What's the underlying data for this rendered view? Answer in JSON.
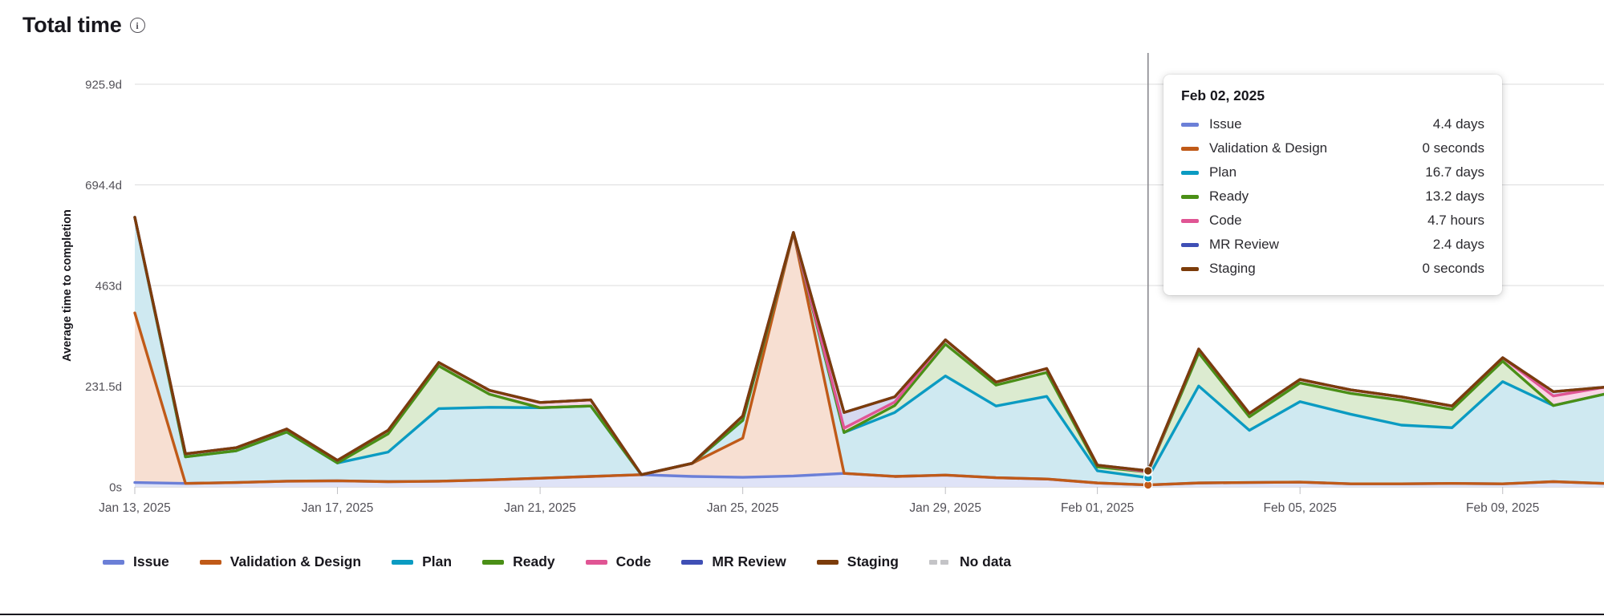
{
  "header": {
    "title": "Total time",
    "info_icon": "info-icon",
    "info_glyph": "i"
  },
  "chart_data": {
    "type": "area",
    "stacked": true,
    "title": "Total time",
    "xlabel": "",
    "ylabel": "Average time to completion",
    "grid": true,
    "legend_position": "bottom",
    "ylim": [
      0,
      925.9
    ],
    "y_ticks": [
      0,
      231.5,
      463,
      694.4,
      925.9
    ],
    "y_tick_labels": [
      "0s",
      "231.5d",
      "463d",
      "694.4d",
      "925.9d"
    ],
    "x_tick_labels": [
      "Jan 13, 2025",
      "Jan 17, 2025",
      "Jan 21, 2025",
      "Jan 25, 2025",
      "Jan 29, 2025",
      "Feb 01, 2025",
      "Feb 05, 2025",
      "Feb 09, 2025"
    ],
    "x_tick_indices": [
      0,
      4,
      8,
      12,
      16,
      19,
      23,
      27
    ],
    "x": [
      "Jan 13, 2025",
      "Jan 14, 2025",
      "Jan 15, 2025",
      "Jan 16, 2025",
      "Jan 17, 2025",
      "Jan 18, 2025",
      "Jan 19, 2025",
      "Jan 20, 2025",
      "Jan 21, 2025",
      "Jan 22, 2025",
      "Jan 23, 2025",
      "Jan 24, 2025",
      "Jan 25, 2025",
      "Jan 26, 2025",
      "Jan 27, 2025",
      "Jan 28, 2025",
      "Jan 29, 2025",
      "Jan 30, 2025",
      "Jan 31, 2025",
      "Feb 01, 2025",
      "Feb 02, 2025",
      "Feb 03, 2025",
      "Feb 04, 2025",
      "Feb 05, 2025",
      "Feb 06, 2025",
      "Feb 07, 2025",
      "Feb 08, 2025",
      "Feb 09, 2025",
      "Feb 10, 2025",
      "Feb 11, 2025"
    ],
    "series": [
      {
        "name": "Issue",
        "color": "#6b7fd7",
        "fill": "#dfe3f7",
        "values": [
          10,
          8,
          10,
          13,
          14,
          12,
          13,
          16,
          20,
          24,
          28,
          24,
          22,
          25,
          31,
          24,
          27,
          21,
          18,
          9,
          4.4,
          9,
          10,
          11,
          7,
          7,
          8,
          7,
          12,
          8
        ]
      },
      {
        "name": "Validation & Design",
        "color": "#c05a18",
        "fill": "#f7dfd2",
        "values": [
          390,
          0,
          0,
          0,
          0,
          0,
          0,
          0,
          0,
          0,
          0,
          30,
          90,
          560,
          0,
          0,
          0,
          0,
          0,
          0,
          0,
          0,
          0,
          0,
          0,
          0,
          0,
          0,
          0,
          0
        ]
      },
      {
        "name": "Plan",
        "color": "#0b9bc2",
        "fill": "#cfe9f1",
        "values": [
          220,
          61,
          73,
          113,
          41,
          68,
          167,
          167,
          162,
          162,
          0,
          0,
          41,
          0,
          94,
          147,
          228,
          165,
          190,
          28,
          16.7,
          223,
          120,
          185,
          160,
          135,
          128,
          235,
          175,
          205
        ]
      },
      {
        "name": "Ready",
        "color": "#4a8f16",
        "fill": "#dcebd0",
        "values": [
          0,
          0,
          0,
          0,
          0,
          42,
          98,
          30,
          0,
          0,
          0,
          0,
          0,
          0,
          0,
          16,
          73,
          48,
          55,
          9,
          13.2,
          76,
          31,
          43,
          48,
          57,
          42,
          47,
          0,
          0
        ]
      },
      {
        "name": "Code",
        "color": "#e05594",
        "fill": "#f9d6e6",
        "values": [
          0,
          7,
          7,
          7,
          6,
          8,
          8,
          9,
          12,
          14,
          0,
          0,
          10,
          0,
          10,
          8,
          10,
          7,
          9,
          4,
          0.2,
          9,
          8,
          8,
          8,
          8,
          8,
          8,
          22,
          16
        ]
      },
      {
        "name": "MR Review",
        "color": "#3f4fb5",
        "fill": "#d6d9f0",
        "values": [
          0,
          0,
          0,
          0,
          0,
          0,
          0,
          0,
          0,
          0,
          0,
          0,
          0,
          0,
          36,
          12,
          0,
          0,
          0,
          0,
          2.4,
          0,
          0,
          0,
          0,
          0,
          0,
          0,
          10,
          0
        ]
      },
      {
        "name": "Staging",
        "color": "#7c3c0a",
        "fill": "#e9ded6",
        "values": [
          0,
          0,
          0,
          0,
          0,
          0,
          0,
          0,
          0,
          0,
          0,
          0,
          0,
          0,
          0,
          0,
          0,
          0,
          0,
          0,
          0,
          0,
          0,
          0,
          0,
          0,
          0,
          0,
          0,
          0
        ]
      }
    ],
    "no_data_color": "#c4c4c7",
    "no_data_label": "No data",
    "hover_index": 20
  },
  "tooltip": {
    "date": "Feb 02, 2025",
    "rows": [
      {
        "name": "Issue",
        "value": "4.4 days",
        "color": "#6b7fd7"
      },
      {
        "name": "Validation & Design",
        "value": "0 seconds",
        "color": "#c05a18"
      },
      {
        "name": "Plan",
        "value": "16.7 days",
        "color": "#0b9bc2"
      },
      {
        "name": "Ready",
        "value": "13.2 days",
        "color": "#4a8f16"
      },
      {
        "name": "Code",
        "value": "4.7 hours",
        "color": "#e05594"
      },
      {
        "name": "MR Review",
        "value": "2.4 days",
        "color": "#3f4fb5"
      },
      {
        "name": "Staging",
        "value": "0 seconds",
        "color": "#7c3c0a"
      }
    ]
  },
  "legend": {
    "items": [
      {
        "label": "Issue",
        "color": "#6b7fd7",
        "style": "solid"
      },
      {
        "label": "Validation & Design",
        "color": "#c05a18",
        "style": "solid"
      },
      {
        "label": "Plan",
        "color": "#0b9bc2",
        "style": "solid"
      },
      {
        "label": "Ready",
        "color": "#4a8f16",
        "style": "solid"
      },
      {
        "label": "Code",
        "color": "#e05594",
        "style": "solid"
      },
      {
        "label": "MR Review",
        "color": "#3f4fb5",
        "style": "solid"
      },
      {
        "label": "Staging",
        "color": "#7c3c0a",
        "style": "solid"
      },
      {
        "label": "No data",
        "color": "#c4c4c7",
        "style": "dashed"
      }
    ]
  }
}
